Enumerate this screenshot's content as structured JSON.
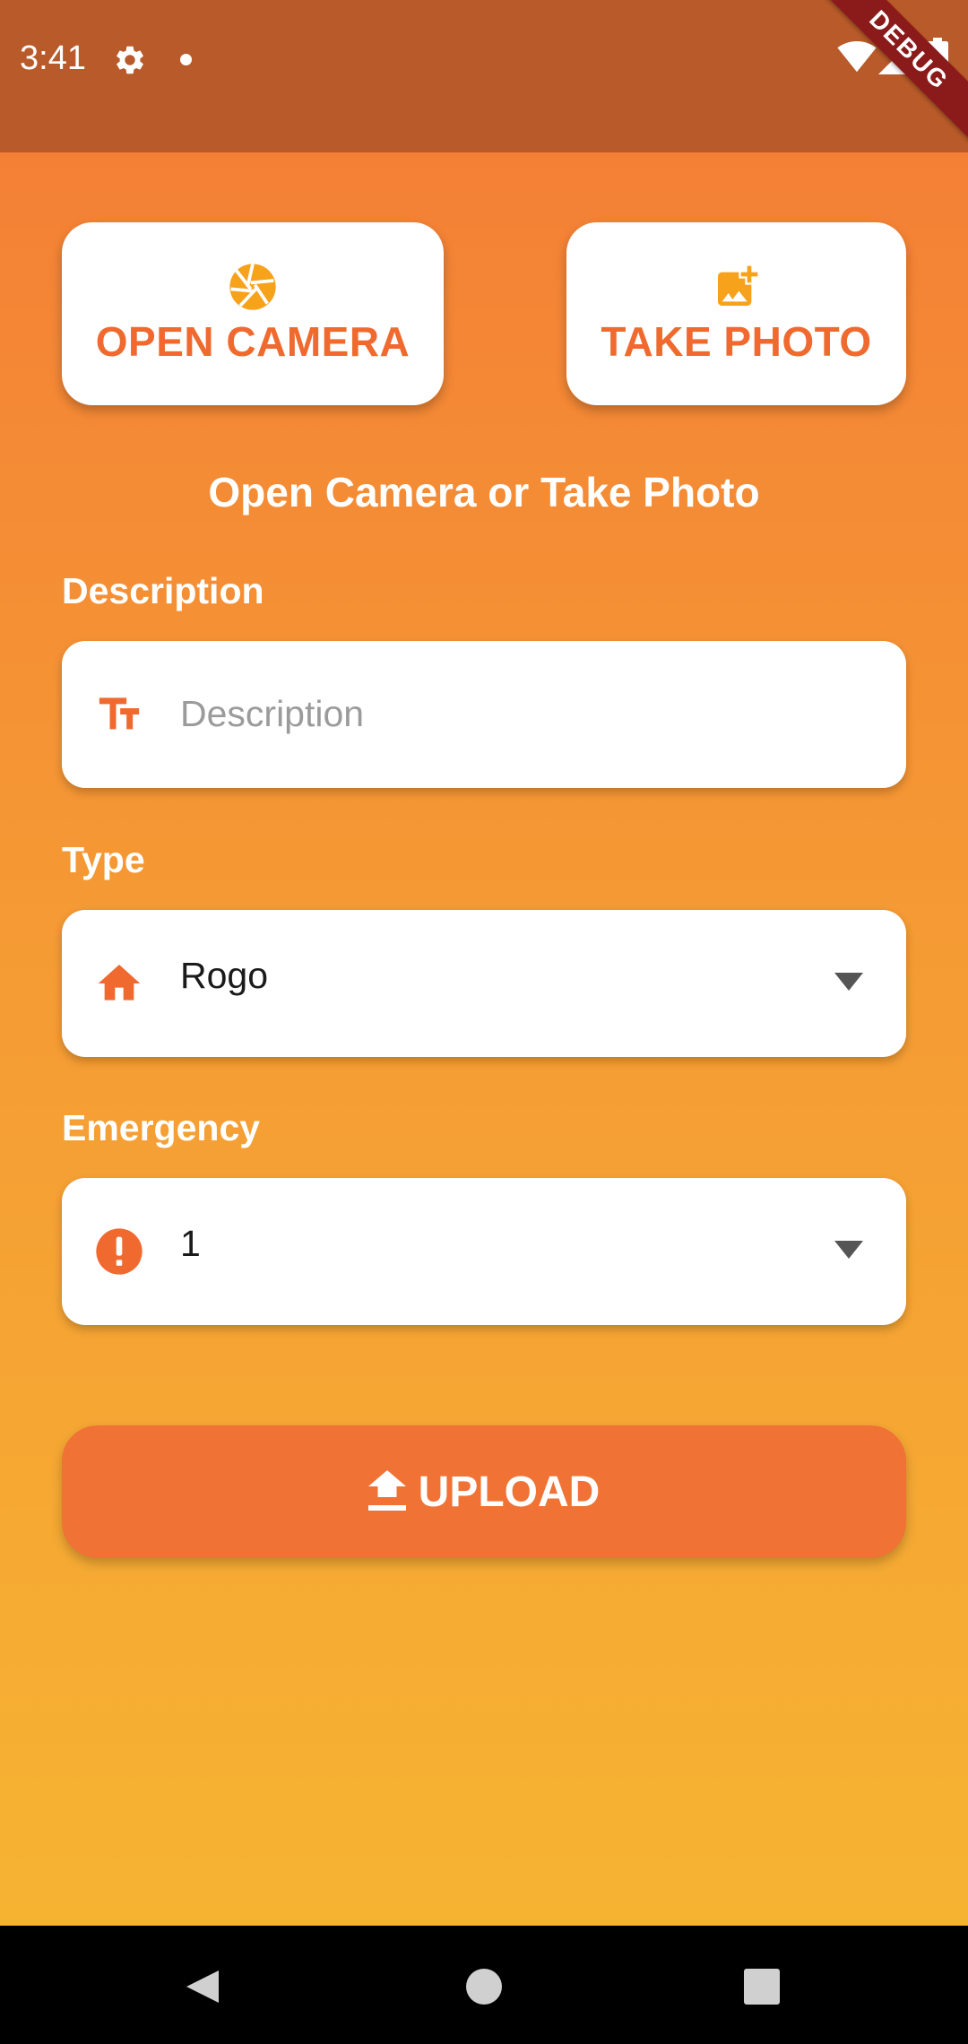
{
  "status_bar": {
    "time": "3:41",
    "debug_banner": "DEBUG",
    "icons": [
      "gear-icon",
      "dot-icon",
      "wifi-icon",
      "signal-icon",
      "battery-icon"
    ]
  },
  "actions": {
    "open_camera": {
      "label": "OPEN CAMERA",
      "icon": "camera-shutter-icon"
    },
    "take_photo": {
      "label": "TAKE PHOTO",
      "icon": "add-photo-icon"
    }
  },
  "hint": "Open Camera or Take Photo",
  "form": {
    "description": {
      "label": "Description",
      "placeholder": "Description",
      "value": "",
      "icon": "text-fields-icon"
    },
    "type": {
      "label": "Type",
      "selected": "Rogo",
      "icon": "home-icon"
    },
    "emergency": {
      "label": "Emergency",
      "selected": "1",
      "icon": "alert-icon"
    }
  },
  "upload": {
    "label": "UPLOAD",
    "icon": "upload-icon"
  },
  "colors": {
    "accent": "#F06A2F",
    "status_bar": "#B85A29",
    "gradient_top": "#F47B36",
    "gradient_bottom": "#F6B632",
    "camera_icon": "#F7A21B"
  },
  "nav": {
    "icons": [
      "back-icon",
      "home-circle-icon",
      "recents-icon"
    ]
  }
}
